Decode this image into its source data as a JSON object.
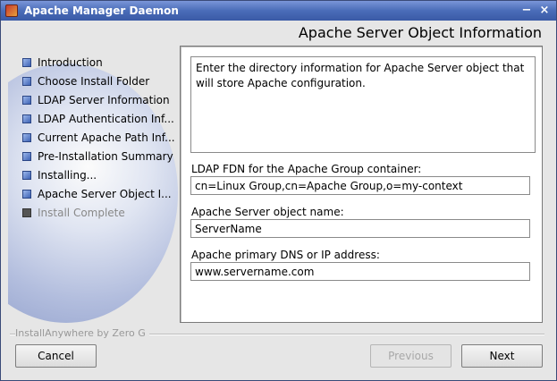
{
  "window": {
    "title": "Apache Manager Daemon",
    "minimize_glyph": "−",
    "close_glyph": "×"
  },
  "header": {
    "title": "Apache Server Object Information"
  },
  "steps": [
    {
      "label": "Introduction",
      "state": "done"
    },
    {
      "label": "Choose Install Folder",
      "state": "done"
    },
    {
      "label": "LDAP Server Information",
      "state": "done"
    },
    {
      "label": "LDAP Authentication Inf...",
      "state": "done"
    },
    {
      "label": "Current Apache Path Inf...",
      "state": "done"
    },
    {
      "label": "Pre-Installation Summary",
      "state": "done"
    },
    {
      "label": "Installing...",
      "state": "done"
    },
    {
      "label": "Apache Server Object I...",
      "state": "current"
    },
    {
      "label": "Install Complete",
      "state": "pending"
    }
  ],
  "panel": {
    "description": "Enter the directory information for Apache Server object that will store Apache configuration.",
    "fields": [
      {
        "label": "LDAP FDN for the Apache Group container:",
        "value": "cn=Linux Group,cn=Apache Group,o=my-context"
      },
      {
        "label": "Apache Server object name:",
        "value": "ServerName"
      },
      {
        "label": "Apache primary DNS or IP address:",
        "value": "www.servername.com"
      }
    ]
  },
  "footer": {
    "brand": "InstallAnywhere by Zero G",
    "cancel_label": "Cancel",
    "previous_label": "Previous",
    "next_label": "Next"
  },
  "colors": {
    "titlebar": "#4a6cb8",
    "background": "#e6e6e6",
    "disabled_text": "#a8a8a8"
  }
}
